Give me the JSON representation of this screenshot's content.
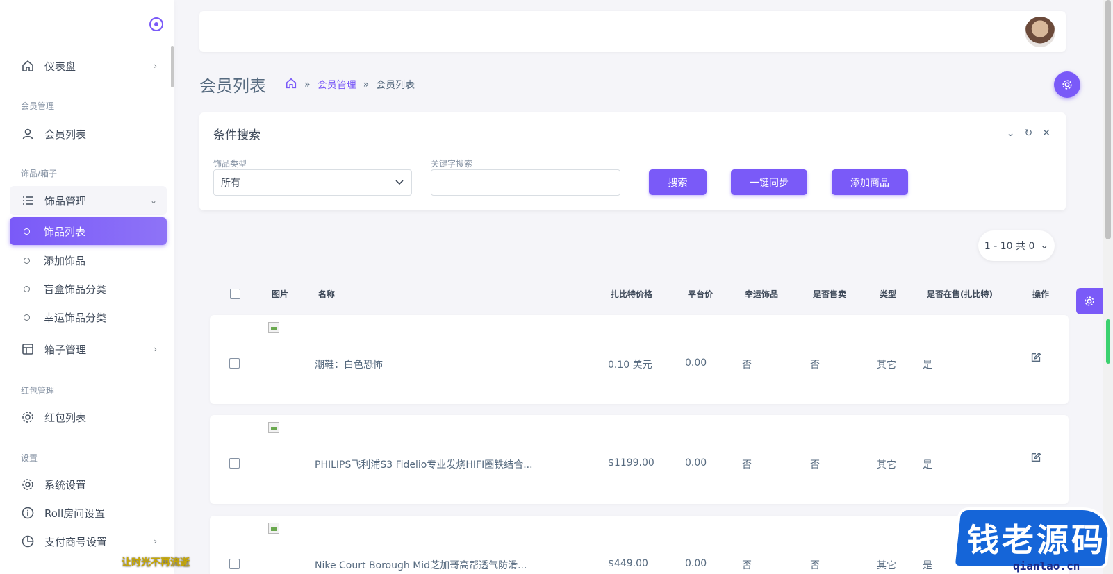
{
  "sidebar": {
    "items": {
      "dashboard": "仪表盘",
      "member_header": "会员管理",
      "member_list": "会员列表",
      "items_header": "饰品/箱子",
      "item_manage": "饰品管理",
      "item_list": "饰品列表",
      "add_item": "添加饰品",
      "blindbox_category": "盲盒饰品分类",
      "lucky_category": "幸运饰品分类",
      "box_manage": "箱子管理",
      "redpack_header": "红包管理",
      "redpack_list": "红包列表",
      "settings_header": "设置",
      "system_settings": "系统设置",
      "roll_settings": "Roll房间设置",
      "payment_settings": "支付商号设置"
    }
  },
  "page": {
    "title": "会员列表",
    "breadcrumb": {
      "parent": "会员管理",
      "current": "会员列表",
      "sep": "»"
    }
  },
  "search": {
    "title": "条件搜索",
    "type_label": "饰品类型",
    "type_value": "所有",
    "keyword_label": "关键字搜索",
    "keyword_value": "",
    "btn_search": "搜索",
    "btn_sync": "一键同步",
    "btn_add": "添加商品"
  },
  "pagination": {
    "label": "1 - 10 共 0"
  },
  "table": {
    "headers": {
      "image": "图片",
      "name": "名称",
      "zbt_price": "扎比特价格",
      "platform_price": "平台价",
      "lucky": "幸运饰品",
      "for_sale": "是否售卖",
      "type": "类型",
      "on_sale_zbt": "是否在售(扎比特)",
      "action": "操作"
    },
    "rows": [
      {
        "name": "潮鞋：白色恐怖",
        "zbt_price": "0.10 美元",
        "platform_price": "0.00",
        "lucky": "否",
        "for_sale": "否",
        "type": "其它",
        "on_sale_zbt": "是"
      },
      {
        "name": "PHILIPS飞利浦S3 Fidelio专业发烧HIFI圈铁结合...",
        "zbt_price": "$1199.00",
        "platform_price": "0.00",
        "lucky": "否",
        "for_sale": "否",
        "type": "其它",
        "on_sale_zbt": "是"
      },
      {
        "name": "Nike Court Borough Mid芝加哥高帮透气防滑...",
        "zbt_price": "$449.00",
        "platform_price": "0.00",
        "lucky": "否",
        "for_sale": "否",
        "type": "其它",
        "on_sale_zbt": "是"
      }
    ]
  },
  "watermark": {
    "main": "钱老源码",
    "sub": "qianlao.cn",
    "left": "让时光不再流逝"
  },
  "colors": {
    "accent": "#7a5af8",
    "background": "#f5f5f9"
  }
}
